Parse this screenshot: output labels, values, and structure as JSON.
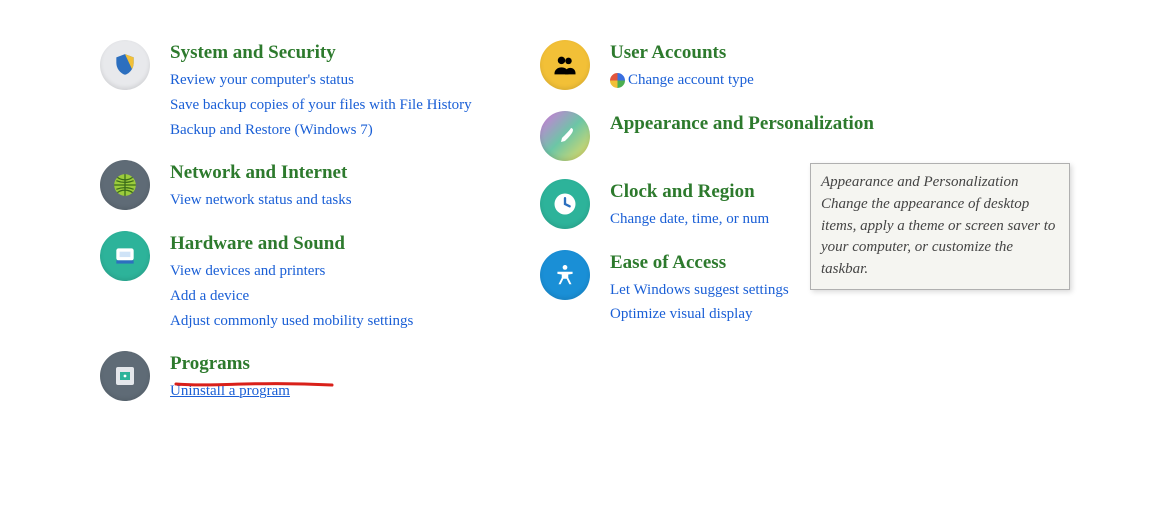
{
  "leftColumn": [
    {
      "title": "System and Security",
      "links": [
        "Review your computer's status",
        "Save backup copies of your files with File History",
        "Backup and Restore (Windows 7)"
      ]
    },
    {
      "title": "Network and Internet",
      "links": [
        "View network status and tasks"
      ]
    },
    {
      "title": "Hardware and Sound",
      "links": [
        "View devices and printers",
        "Add a device",
        "Adjust commonly used mobility settings"
      ]
    },
    {
      "title": "Programs",
      "links": [
        "Uninstall a program"
      ]
    }
  ],
  "rightColumn": [
    {
      "title": "User Accounts",
      "links": [
        "Change account type"
      ]
    },
    {
      "title": "Appearance and Personalization",
      "links": []
    },
    {
      "title": "Clock and Region",
      "links": [
        "Change date, time, or num"
      ]
    },
    {
      "title": "Ease of Access",
      "links": [
        "Let Windows suggest settings",
        "Optimize visual display"
      ]
    }
  ],
  "tooltip": {
    "title": "Appearance and Personalization",
    "body": "Change the appearance of desktop items, apply a theme or screen saver to your computer, or customize the taskbar."
  }
}
